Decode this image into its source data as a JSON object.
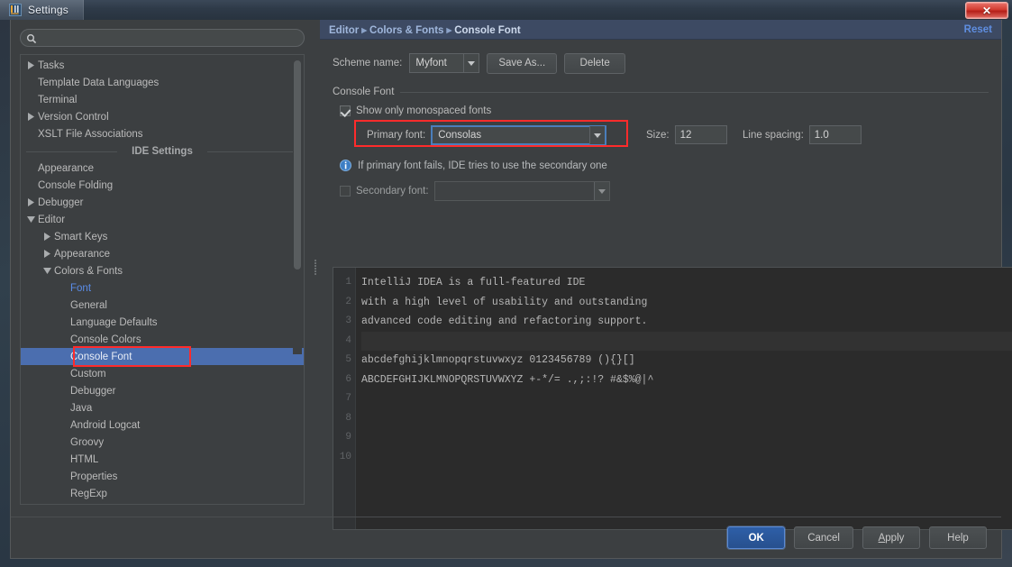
{
  "window": {
    "title": "Settings",
    "app_icon": "intellij-idea-icon",
    "close_label": "✕"
  },
  "sidebar": {
    "search": {
      "value": "",
      "placeholder": "",
      "icon": "search-icon"
    },
    "tree": [
      {
        "label": "Tasks",
        "arrow": "collapsed",
        "indent": 0
      },
      {
        "label": "Template Data Languages",
        "arrow": "none",
        "indent": 0
      },
      {
        "label": "Terminal",
        "arrow": "none",
        "indent": 0
      },
      {
        "label": "Version Control",
        "arrow": "collapsed",
        "indent": 0
      },
      {
        "label": "XSLT File Associations",
        "arrow": "none",
        "indent": 0
      },
      {
        "label": "IDE Settings",
        "arrow": "separator",
        "indent": 0
      },
      {
        "label": "Appearance",
        "arrow": "none",
        "indent": 0
      },
      {
        "label": "Console Folding",
        "arrow": "none",
        "indent": 0
      },
      {
        "label": "Debugger",
        "arrow": "collapsed",
        "indent": 0
      },
      {
        "label": "Editor",
        "arrow": "expanded",
        "indent": 0
      },
      {
        "label": "Smart Keys",
        "arrow": "collapsed",
        "indent": 1
      },
      {
        "label": "Appearance",
        "arrow": "collapsed",
        "indent": 1
      },
      {
        "label": "Colors & Fonts",
        "arrow": "expanded",
        "indent": 1
      },
      {
        "label": "Font",
        "arrow": "none",
        "indent": 2,
        "style": "blue"
      },
      {
        "label": "General",
        "arrow": "none",
        "indent": 2
      },
      {
        "label": "Language Defaults",
        "arrow": "none",
        "indent": 2
      },
      {
        "label": "Console Colors",
        "arrow": "none",
        "indent": 2
      },
      {
        "label": "Console Font",
        "arrow": "none",
        "indent": 2,
        "style": "selected",
        "annotated": true
      },
      {
        "label": "Custom",
        "arrow": "none",
        "indent": 2
      },
      {
        "label": "Debugger",
        "arrow": "none",
        "indent": 2
      },
      {
        "label": "Java",
        "arrow": "none",
        "indent": 2
      },
      {
        "label": "Android Logcat",
        "arrow": "none",
        "indent": 2
      },
      {
        "label": "Groovy",
        "arrow": "none",
        "indent": 2
      },
      {
        "label": "HTML",
        "arrow": "none",
        "indent": 2
      },
      {
        "label": "Properties",
        "arrow": "none",
        "indent": 2
      },
      {
        "label": "RegExp",
        "arrow": "none",
        "indent": 2
      }
    ]
  },
  "main": {
    "breadcrumb": {
      "parts": [
        "Editor",
        "Colors & Fonts",
        "Console Font"
      ],
      "separator": "▸"
    },
    "reset_label": "Reset",
    "scheme": {
      "label": "Scheme name:",
      "value": "Myfont",
      "save_as_label": "Save As...",
      "delete_label": "Delete"
    },
    "group_title": "Console Font",
    "monospaced": {
      "label": "Show only monospaced fonts",
      "checked": true
    },
    "primary_font": {
      "label": "Primary font:",
      "value": "Consolas"
    },
    "size": {
      "label": "Size:",
      "value": "12"
    },
    "line_spacing": {
      "label": "Line spacing:",
      "value": "1.0"
    },
    "info_message": "If primary font fails, IDE tries to use the secondary one",
    "info_icon": "info-icon",
    "secondary_font": {
      "label": "Secondary font:",
      "value": "",
      "checked": false
    },
    "preview": {
      "line_numbers": [
        "1",
        "2",
        "3",
        "4",
        "5",
        "6",
        "7",
        "8",
        "9",
        "10"
      ],
      "lines": [
        "IntelliJ IDEA is a full-featured IDE",
        "with a high level of usability and outstanding",
        "advanced code editing and refactoring support.",
        "",
        "abcdefghijklmnopqrstuvwxyz 0123456789 (){}[]",
        "ABCDEFGHIJKLMNOPQRSTUVWXYZ +-*/= .,;:!? #&$%@|^",
        "",
        "",
        "",
        ""
      ],
      "caret_line_index": 3,
      "marker": "bookmark-marker"
    }
  },
  "footer": {
    "ok": "OK",
    "cancel": "Cancel",
    "apply": "Apply",
    "help": "Help"
  },
  "colors": {
    "accent_selection": "#4b6eaf",
    "annotation_red": "#ff2b2b",
    "focus_blue": "#4a7ebb",
    "link_blue": "#5f8ee0",
    "marker_orange": "#f0a732",
    "editor_bg": "#2b2b2b",
    "panel_bg": "#3c3f41"
  }
}
